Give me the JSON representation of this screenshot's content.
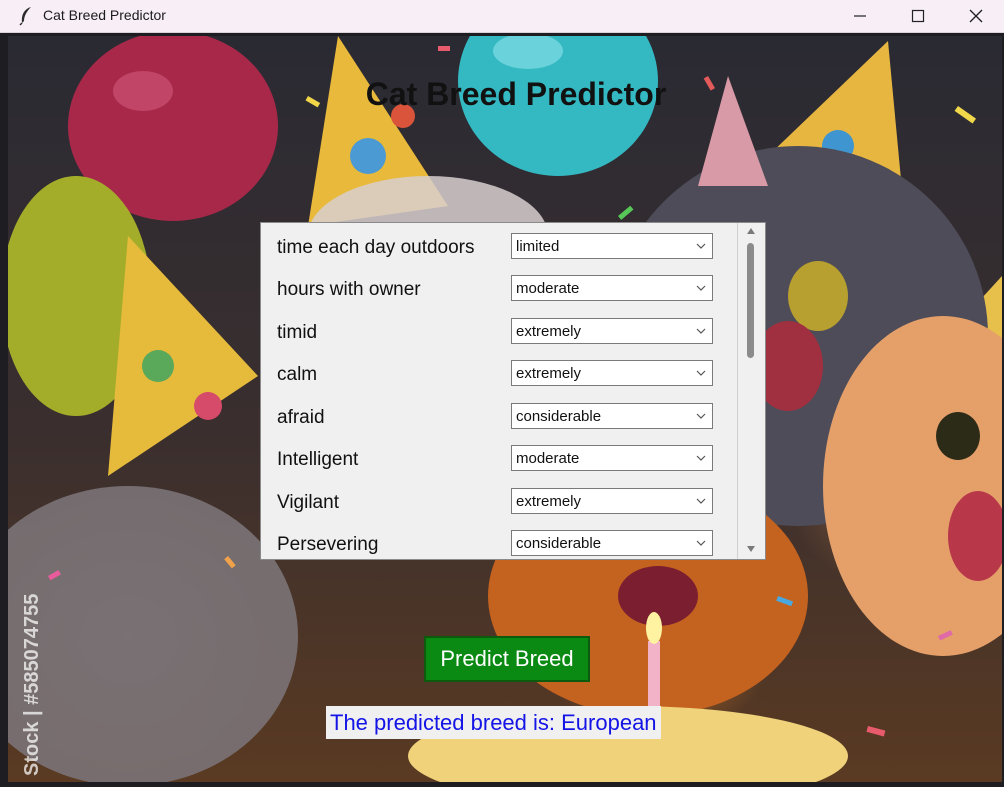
{
  "window": {
    "title": "Cat Breed Predictor",
    "controls": {
      "minimize_icon": "minimize-icon",
      "maximize_icon": "maximize-icon",
      "close_icon": "close-icon"
    }
  },
  "background": {
    "description_icon": "party-cats-illustration",
    "watermark": "Stock | #585074755"
  },
  "main": {
    "title": "Cat Breed Predictor"
  },
  "form": {
    "fields": [
      {
        "label": "time each day outdoors",
        "value": "limited"
      },
      {
        "label": "hours with owner",
        "value": "moderate"
      },
      {
        "label": "timid",
        "value": "extremely"
      },
      {
        "label": "calm",
        "value": "extremely"
      },
      {
        "label": "afraid",
        "value": "considerable"
      },
      {
        "label": "Intelligent",
        "value": "moderate"
      },
      {
        "label": "Vigilant",
        "value": "extremely"
      },
      {
        "label": "Persevering",
        "value": "considerable"
      }
    ]
  },
  "actions": {
    "predict_label": "Predict Breed",
    "predict_color": "#0a8a12"
  },
  "result": {
    "text": "The predicted breed is: European",
    "color": "#1414e6"
  }
}
